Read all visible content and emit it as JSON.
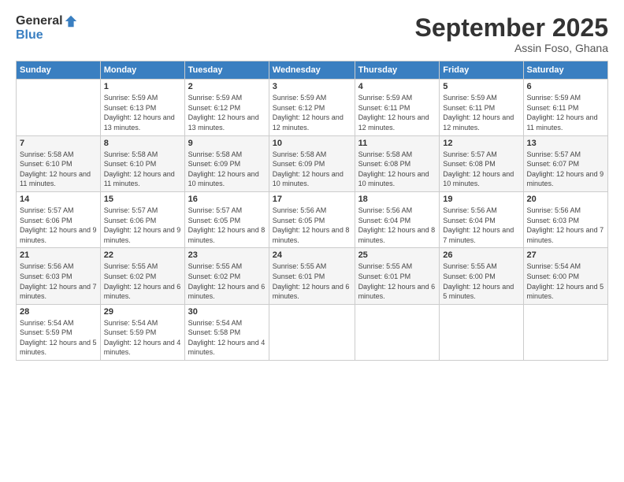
{
  "logo": {
    "general": "General",
    "blue": "Blue"
  },
  "title": "September 2025",
  "location": "Assin Foso, Ghana",
  "days_of_week": [
    "Sunday",
    "Monday",
    "Tuesday",
    "Wednesday",
    "Thursday",
    "Friday",
    "Saturday"
  ],
  "weeks": [
    [
      {
        "day": "",
        "info": ""
      },
      {
        "day": "1",
        "info": "Sunrise: 5:59 AM\nSunset: 6:13 PM\nDaylight: 12 hours\nand 13 minutes."
      },
      {
        "day": "2",
        "info": "Sunrise: 5:59 AM\nSunset: 6:12 PM\nDaylight: 12 hours\nand 13 minutes."
      },
      {
        "day": "3",
        "info": "Sunrise: 5:59 AM\nSunset: 6:12 PM\nDaylight: 12 hours\nand 12 minutes."
      },
      {
        "day": "4",
        "info": "Sunrise: 5:59 AM\nSunset: 6:11 PM\nDaylight: 12 hours\nand 12 minutes."
      },
      {
        "day": "5",
        "info": "Sunrise: 5:59 AM\nSunset: 6:11 PM\nDaylight: 12 hours\nand 12 minutes."
      },
      {
        "day": "6",
        "info": "Sunrise: 5:59 AM\nSunset: 6:11 PM\nDaylight: 12 hours\nand 11 minutes."
      }
    ],
    [
      {
        "day": "7",
        "info": "Sunrise: 5:58 AM\nSunset: 6:10 PM\nDaylight: 12 hours\nand 11 minutes."
      },
      {
        "day": "8",
        "info": "Sunrise: 5:58 AM\nSunset: 6:10 PM\nDaylight: 12 hours\nand 11 minutes."
      },
      {
        "day": "9",
        "info": "Sunrise: 5:58 AM\nSunset: 6:09 PM\nDaylight: 12 hours\nand 10 minutes."
      },
      {
        "day": "10",
        "info": "Sunrise: 5:58 AM\nSunset: 6:09 PM\nDaylight: 12 hours\nand 10 minutes."
      },
      {
        "day": "11",
        "info": "Sunrise: 5:58 AM\nSunset: 6:08 PM\nDaylight: 12 hours\nand 10 minutes."
      },
      {
        "day": "12",
        "info": "Sunrise: 5:57 AM\nSunset: 6:08 PM\nDaylight: 12 hours\nand 10 minutes."
      },
      {
        "day": "13",
        "info": "Sunrise: 5:57 AM\nSunset: 6:07 PM\nDaylight: 12 hours\nand 9 minutes."
      }
    ],
    [
      {
        "day": "14",
        "info": "Sunrise: 5:57 AM\nSunset: 6:06 PM\nDaylight: 12 hours\nand 9 minutes."
      },
      {
        "day": "15",
        "info": "Sunrise: 5:57 AM\nSunset: 6:06 PM\nDaylight: 12 hours\nand 9 minutes."
      },
      {
        "day": "16",
        "info": "Sunrise: 5:57 AM\nSunset: 6:05 PM\nDaylight: 12 hours\nand 8 minutes."
      },
      {
        "day": "17",
        "info": "Sunrise: 5:56 AM\nSunset: 6:05 PM\nDaylight: 12 hours\nand 8 minutes."
      },
      {
        "day": "18",
        "info": "Sunrise: 5:56 AM\nSunset: 6:04 PM\nDaylight: 12 hours\nand 8 minutes."
      },
      {
        "day": "19",
        "info": "Sunrise: 5:56 AM\nSunset: 6:04 PM\nDaylight: 12 hours\nand 7 minutes."
      },
      {
        "day": "20",
        "info": "Sunrise: 5:56 AM\nSunset: 6:03 PM\nDaylight: 12 hours\nand 7 minutes."
      }
    ],
    [
      {
        "day": "21",
        "info": "Sunrise: 5:56 AM\nSunset: 6:03 PM\nDaylight: 12 hours\nand 7 minutes."
      },
      {
        "day": "22",
        "info": "Sunrise: 5:55 AM\nSunset: 6:02 PM\nDaylight: 12 hours\nand 6 minutes."
      },
      {
        "day": "23",
        "info": "Sunrise: 5:55 AM\nSunset: 6:02 PM\nDaylight: 12 hours\nand 6 minutes."
      },
      {
        "day": "24",
        "info": "Sunrise: 5:55 AM\nSunset: 6:01 PM\nDaylight: 12 hours\nand 6 minutes."
      },
      {
        "day": "25",
        "info": "Sunrise: 5:55 AM\nSunset: 6:01 PM\nDaylight: 12 hours\nand 6 minutes."
      },
      {
        "day": "26",
        "info": "Sunrise: 5:55 AM\nSunset: 6:00 PM\nDaylight: 12 hours\nand 5 minutes."
      },
      {
        "day": "27",
        "info": "Sunrise: 5:54 AM\nSunset: 6:00 PM\nDaylight: 12 hours\nand 5 minutes."
      }
    ],
    [
      {
        "day": "28",
        "info": "Sunrise: 5:54 AM\nSunset: 5:59 PM\nDaylight: 12 hours\nand 5 minutes."
      },
      {
        "day": "29",
        "info": "Sunrise: 5:54 AM\nSunset: 5:59 PM\nDaylight: 12 hours\nand 4 minutes."
      },
      {
        "day": "30",
        "info": "Sunrise: 5:54 AM\nSunset: 5:58 PM\nDaylight: 12 hours\nand 4 minutes."
      },
      {
        "day": "",
        "info": ""
      },
      {
        "day": "",
        "info": ""
      },
      {
        "day": "",
        "info": ""
      },
      {
        "day": "",
        "info": ""
      }
    ]
  ]
}
